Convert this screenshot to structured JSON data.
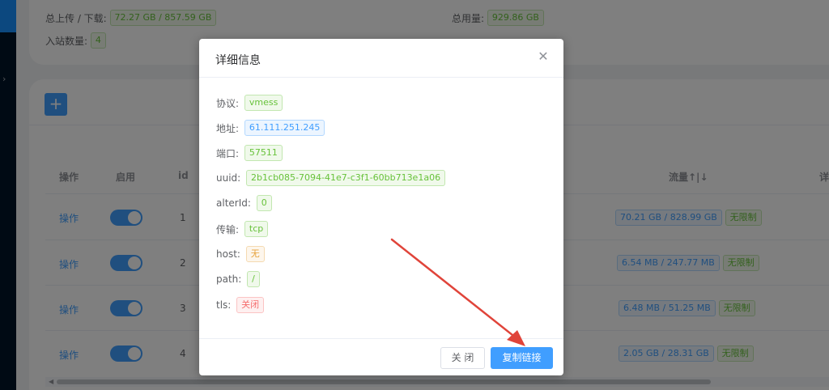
{
  "summary": {
    "upload_download_label": "总上传 / 下载:",
    "upload_download_value": "72.27 GB / 857.59 GB",
    "total_usage_label": "总用量:",
    "total_usage_value": "929.86 GB",
    "inbound_count_label": "入站数量:",
    "inbound_count_value": "4"
  },
  "table": {
    "add_icon": "plus-icon",
    "headers": {
      "operation": "操作",
      "enable": "启用",
      "id": "id",
      "traffic": "流量↑|↓",
      "detail": "详"
    },
    "rows": [
      {
        "op": "操作",
        "enabled": true,
        "id": "1",
        "traffic": "70.21 GB / 828.99 GB",
        "limit": "无限制"
      },
      {
        "op": "操作",
        "enabled": true,
        "id": "2",
        "traffic": "6.54 MB / 247.77 MB",
        "limit": "无限制"
      },
      {
        "op": "操作",
        "enabled": true,
        "id": "3",
        "traffic": "6.48 MB / 51.25 MB",
        "limit": "无限制"
      },
      {
        "op": "操作",
        "enabled": true,
        "id": "4",
        "traffic": "2.05 GB / 28.31 GB",
        "limit": "无限制"
      }
    ]
  },
  "dialog": {
    "title": "详细信息",
    "close_icon": "close-icon",
    "fields": {
      "protocol": {
        "label": "协议:",
        "value": "vmess"
      },
      "address": {
        "label": "地址:",
        "value": "61.111.251.245"
      },
      "port": {
        "label": "端口:",
        "value": "57511"
      },
      "uuid": {
        "label": "uuid:",
        "value": "2b1cb085-7094-41e7-c3f1-60bb713e1a06"
      },
      "alterid": {
        "label": "alterId:",
        "value": "0"
      },
      "transport": {
        "label": "传输:",
        "value": "tcp"
      },
      "host": {
        "label": "host:",
        "value": "无"
      },
      "path": {
        "label": "path:",
        "value": "/"
      },
      "tls": {
        "label": "tls:",
        "value": "关闭"
      }
    },
    "cancel_label": "关 闭",
    "copy_label": "复制链接"
  },
  "colors": {
    "primary": "#409eff",
    "success": "#67c23a",
    "warning": "#e6a23c",
    "danger": "#f56c6c",
    "annotation_arrow": "#e0443a",
    "sidebar": "#001529"
  }
}
